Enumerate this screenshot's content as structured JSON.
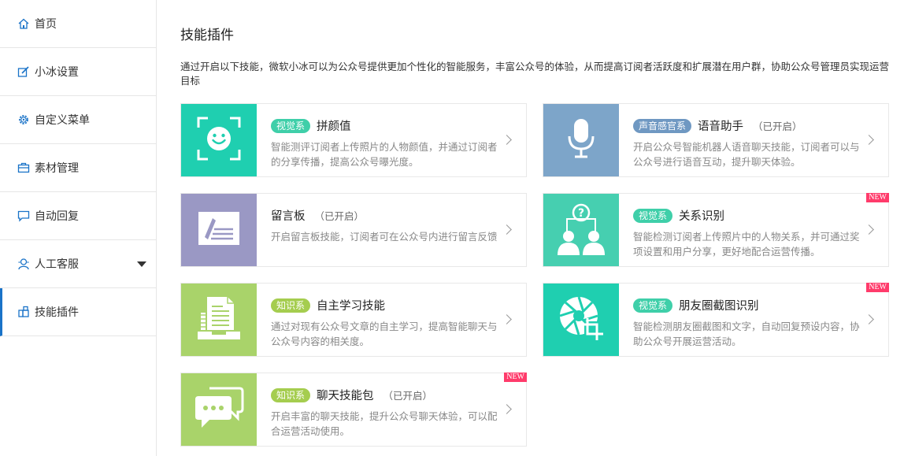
{
  "sidebar": {
    "items": [
      {
        "label": "首页",
        "icon": "home-icon"
      },
      {
        "label": "小冰设置",
        "icon": "edit-icon"
      },
      {
        "label": "自定义菜单",
        "icon": "gear-icon"
      },
      {
        "label": "素材管理",
        "icon": "briefcase-icon"
      },
      {
        "label": "自动回复",
        "icon": "chat-icon"
      },
      {
        "label": "人工客服",
        "icon": "user-service-icon"
      },
      {
        "label": "技能插件",
        "icon": "plugin-icon"
      }
    ]
  },
  "main": {
    "title": "技能插件",
    "description": "通过开启以下技能，微软小冰可以为公众号提供更加个性化的智能服务，丰富公众号的体验，从而提高订阅者活跃度和扩展潜在用户群，协助公众号管理员实现运营目标"
  },
  "skills": [
    {
      "tag": "视觉系",
      "name": "拼颜值",
      "status": "",
      "text": "智能测评订阅者上传照片的人物颜值，并通过订阅者的分享传播，提高公众号曝光度。",
      "new": "",
      "thumb_color": "#1fcfb0",
      "tag_color": "#3fcfa9",
      "icon": "smiley-face-icon"
    },
    {
      "tag": "声音感官系",
      "name": "语音助手",
      "status": "（已开启）",
      "text": "开启公众号智能机器人语音聊天技能，订阅者可以与公众号进行语音互动，提升聊天体验。",
      "new": "",
      "thumb_color": "#7da5c9",
      "tag_color": "#6f98c2",
      "icon": "microphone-icon"
    },
    {
      "tag": "",
      "name": "留言板",
      "status": "（已开启）",
      "text": "开启留言板技能，订阅者可在公众号内进行留言反馈",
      "new": "",
      "thumb_color": "#9a98c4",
      "tag_color": "",
      "icon": "message-board-icon"
    },
    {
      "tag": "视觉系",
      "name": "关系识别",
      "status": "",
      "text": "智能检测订阅者上传照片中的人物关系，并可通过奖项设置和用户分享，更好地配合运营传播。",
      "new": "NEW",
      "thumb_color": "#46cfb0",
      "tag_color": "#3fcfa9",
      "icon": "people-relation-icon"
    },
    {
      "tag": "知识系",
      "name": "自主学习技能",
      "status": "",
      "text": "通过对现有公众号文章的自主学习，提高智能聊天与公众号内容的相关度。",
      "new": "",
      "thumb_color": "#a9d36a",
      "tag_color": "#a5cd4f",
      "icon": "document-stack-icon"
    },
    {
      "tag": "视觉系",
      "name": "朋友圈截图识别",
      "status": "",
      "text": "智能检测朋友圈截图和文字，自动回复预设内容，协助公众号开展运营活动。",
      "new": "NEW",
      "thumb_color": "#1fcfb0",
      "tag_color": "#3fcfa9",
      "icon": "aperture-crop-icon"
    },
    {
      "tag": "知识系",
      "name": "聊天技能包",
      "status": "（已开启）",
      "text": "开启丰富的聊天技能，提升公众号聊天体验，可以配合运营活动使用。",
      "new": "NEW",
      "thumb_color": "#a9d36a",
      "tag_color": "#a5cd4f",
      "icon": "chat-bubbles-icon"
    }
  ]
}
